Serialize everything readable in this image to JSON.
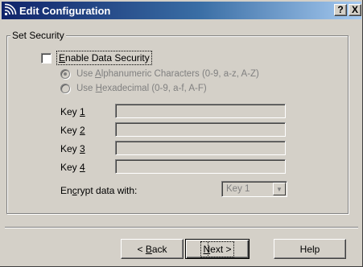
{
  "window": {
    "title": "Edit Configuration",
    "help_button": "?",
    "close_button": "X"
  },
  "group": {
    "title": "Set Security"
  },
  "enable_security": {
    "label_pre": "",
    "label_mnemonic": "E",
    "label_post": "nable Data Security",
    "checked": false
  },
  "radio_alpha": {
    "label_pre": "Use ",
    "label_mnemonic": "A",
    "label_post": "lphanumeric Characters (0-9, a-z, A-Z)",
    "selected": true,
    "enabled": false
  },
  "radio_hex": {
    "label_pre": "Use ",
    "label_mnemonic": "H",
    "label_post": "exadecimal (0-9, a-f, A-F)",
    "selected": false,
    "enabled": false
  },
  "keys": [
    {
      "label_pre": "Key ",
      "label_mnemonic": "1",
      "value": ""
    },
    {
      "label_pre": "Key ",
      "label_mnemonic": "2",
      "value": ""
    },
    {
      "label_pre": "Key ",
      "label_mnemonic": "3",
      "value": ""
    },
    {
      "label_pre": "Key ",
      "label_mnemonic": "4",
      "value": ""
    }
  ],
  "encrypt": {
    "label_pre": "En",
    "label_mnemonic": "c",
    "label_post": "rypt data with:",
    "selected": "Key 1"
  },
  "buttons": {
    "back_pre": "< ",
    "back_mnemonic": "B",
    "back_post": "ack",
    "next_mnemonic": "N",
    "next_post": "ext >",
    "help": "Help"
  },
  "colors": {
    "face": "#d4d0c8",
    "title_start": "#10246a",
    "title_end": "#a6caf0",
    "disabled_text": "#808080"
  }
}
